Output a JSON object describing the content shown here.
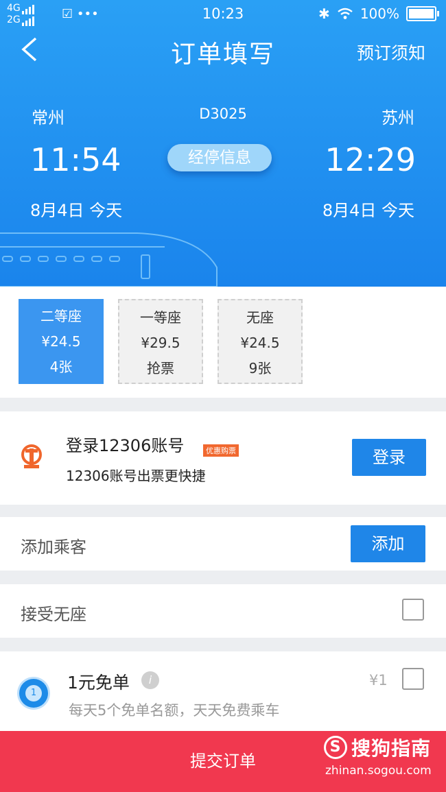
{
  "status_bar": {
    "signal_top": "4G",
    "signal_bottom": "2G",
    "extra_icons": "☑ •••",
    "time": "10:23",
    "battery": "100%"
  },
  "nav": {
    "title": "订单填写",
    "right_link": "预订须知"
  },
  "trip": {
    "from_city": "常州",
    "to_city": "苏州",
    "train_no": "D3025",
    "depart_time": "11:54",
    "arrive_time": "12:29",
    "stop_info_label": "经停信息",
    "depart_date": "8月4日 今天",
    "arrive_date": "8月4日 今天"
  },
  "seats": [
    {
      "name": "二等座",
      "price": "¥24.5",
      "status": "4张",
      "selected": true
    },
    {
      "name": "一等座",
      "price": "¥29.5",
      "status": "抢票",
      "selected": false
    },
    {
      "name": "无座",
      "price": "¥24.5",
      "status": "9张",
      "selected": false
    }
  ],
  "login": {
    "title": "登录12306账号",
    "promo_badge": "优惠购票",
    "subtitle": "12306账号出票更快捷",
    "button": "登录"
  },
  "passengers": {
    "label": "添加乘客",
    "button": "添加"
  },
  "accept_no_seat": {
    "label": "接受无座",
    "checked": false
  },
  "free_ticket": {
    "title": "1元免单",
    "info_icon": "i",
    "subtitle": "每天5个免单名额，天天免费乘车",
    "price": "¥1",
    "checked": false
  },
  "submit": {
    "label": "提交订单"
  },
  "watermark": {
    "logo_text": "搜狗指南",
    "logo_letter": "S",
    "url": "zhinan.sogou.com"
  },
  "colors": {
    "header_blue": "#1a84ec",
    "button_blue": "#1f86e8",
    "submit_red": "#f1384f",
    "promo_orange": "#f1682f"
  }
}
